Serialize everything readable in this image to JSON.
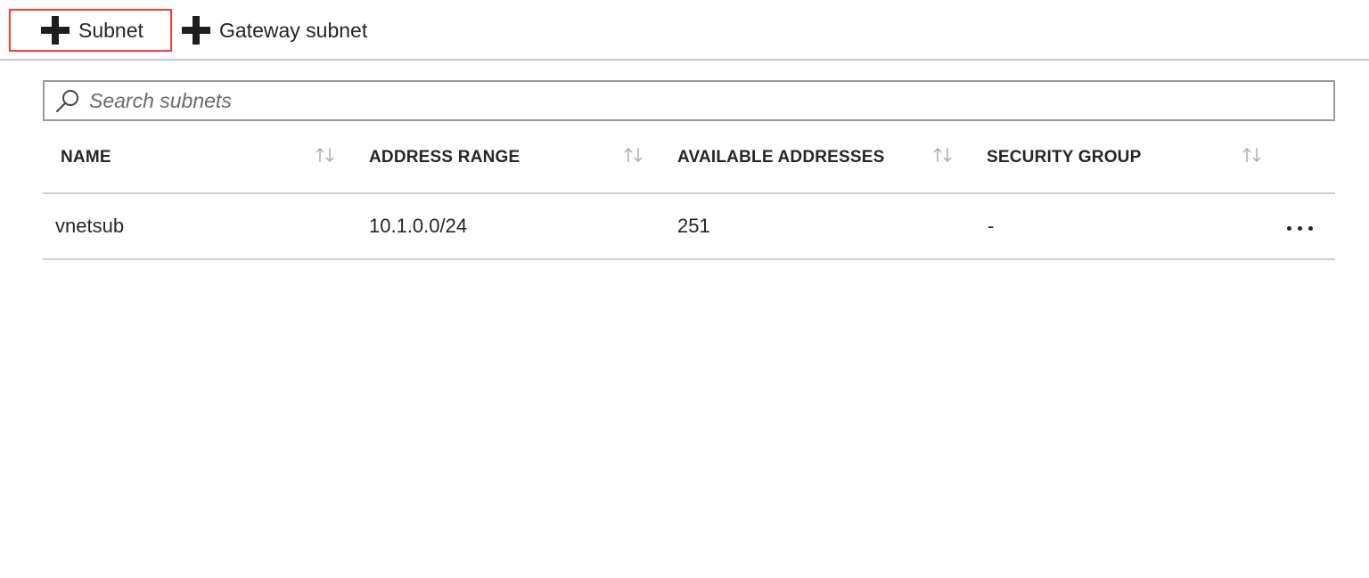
{
  "toolbar": {
    "subnet_label": "Subnet",
    "gateway_subnet_label": "Gateway subnet"
  },
  "search": {
    "placeholder": "Search subnets",
    "value": ""
  },
  "table": {
    "columns": [
      "NAME",
      "ADDRESS RANGE",
      "AVAILABLE ADDRESSES",
      "SECURITY GROUP"
    ],
    "rows": [
      {
        "name": "vnetsub",
        "address_range": "10.1.0.0/24",
        "available_addresses": "251",
        "security_group": "-"
      }
    ]
  },
  "icons": {
    "add": "plus-icon",
    "search": "search-icon",
    "sort": "sort-icon",
    "more": "more-icon"
  },
  "colors": {
    "highlight_border": "#e04a4a",
    "divider": "#d0d0d0",
    "text": "#262626"
  }
}
